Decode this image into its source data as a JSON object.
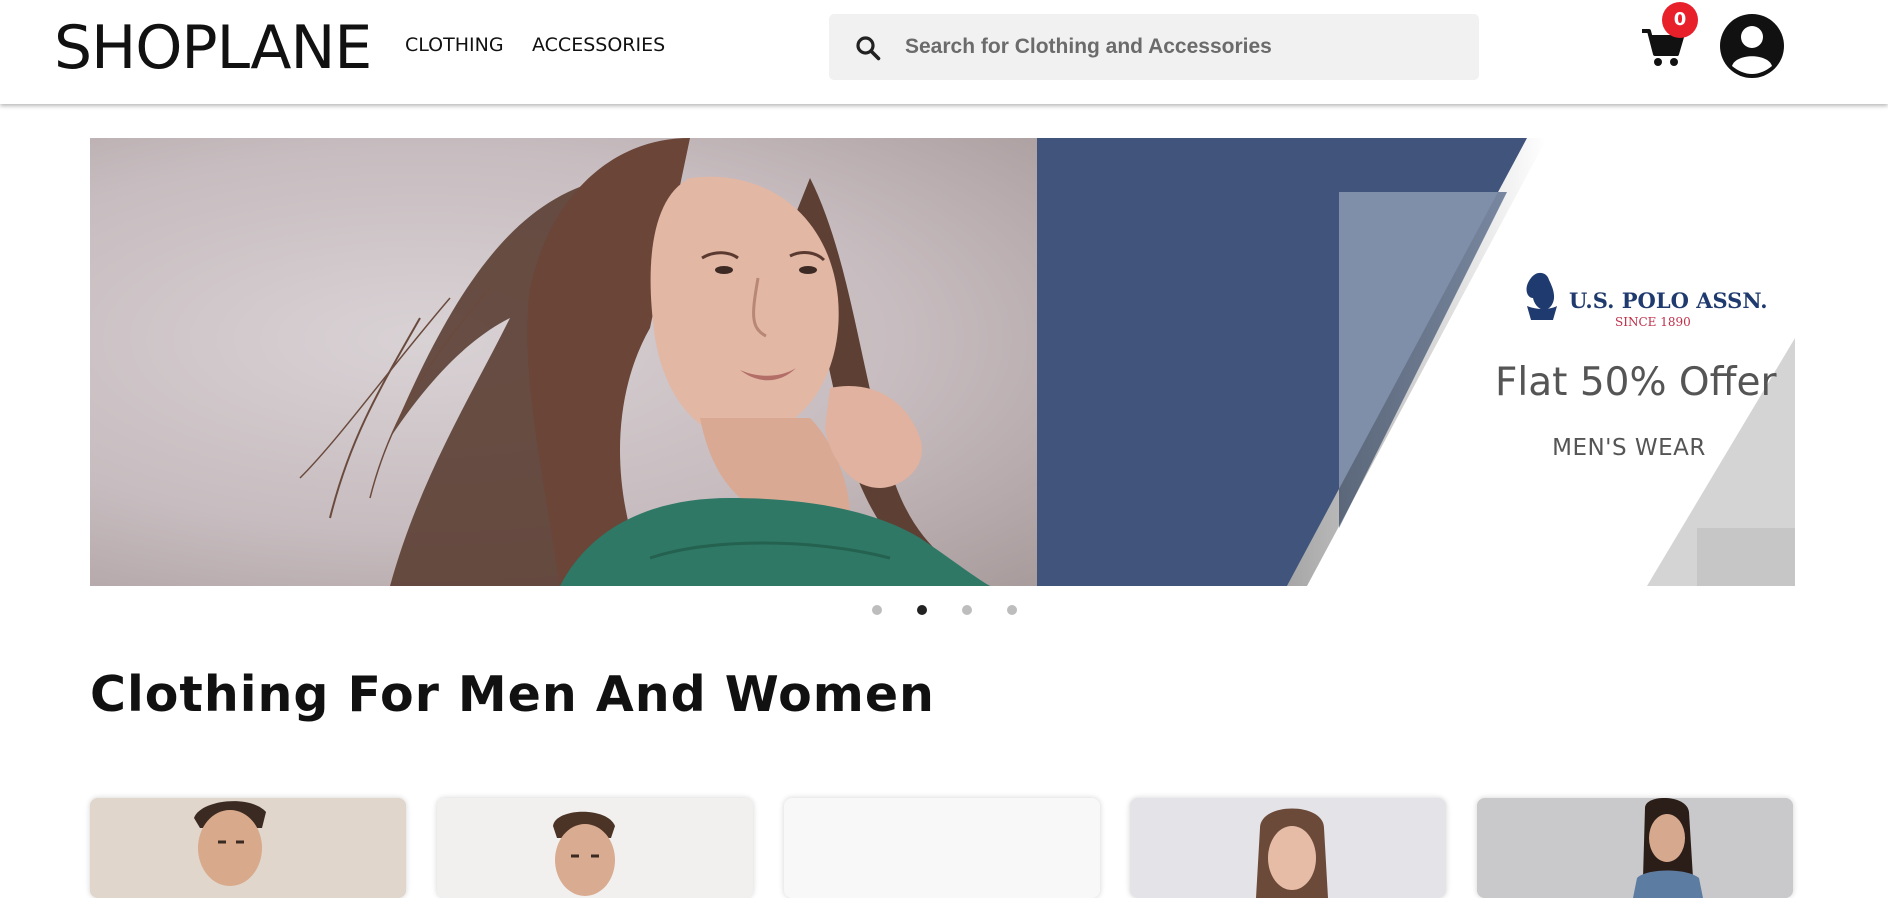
{
  "header": {
    "logo": {
      "shop": "SHOP",
      "lane": "LANE"
    },
    "nav": [
      {
        "label": "CLOTHING"
      },
      {
        "label": "ACCESSORIES"
      }
    ],
    "search": {
      "placeholder": "Search for Clothing and Accessories",
      "value": "",
      "icon": "search-icon"
    },
    "cart": {
      "count": "0",
      "icon": "cart-icon",
      "badge_color": "#e8202a"
    },
    "account": {
      "icon": "user-avatar-icon"
    }
  },
  "banner": {
    "brand": {
      "name": "U.S. POLO ASSN.",
      "since": "SINCE 1890"
    },
    "headline": "Flat 50% Offer",
    "subline": "MEN'S WEAR",
    "colors": {
      "panel": "#41557c",
      "tint": "#7f8fa9"
    }
  },
  "carousel": {
    "slides": 4,
    "active_index": 1
  },
  "section": {
    "title": "Clothing For Men And Women"
  },
  "products": [
    {
      "name": "product-card-men-1"
    },
    {
      "name": "product-card-men-2"
    },
    {
      "name": "product-card-blank"
    },
    {
      "name": "product-card-women-1"
    },
    {
      "name": "product-card-women-2"
    }
  ]
}
